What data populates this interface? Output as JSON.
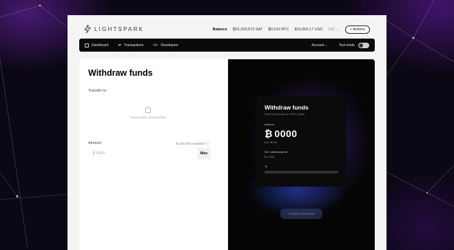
{
  "app": {
    "logo_text": "LIGHTSPARK"
  },
  "header": {
    "balance_label": "Balance",
    "balance_sat": "₿61,925,572 SAT",
    "balance_btc": "₿0.619 BTC",
    "balance_usd": "$10,666.17 USD",
    "unit_selector": "SAT",
    "actions_label": "+ Actions"
  },
  "nav": {
    "items": [
      {
        "label": "Dashboard",
        "icon": "dashboard-icon"
      },
      {
        "label": "Transactions",
        "icon": "transactions-icon"
      },
      {
        "label": "Developers",
        "icon": "code-icon"
      }
    ],
    "account_label": "Account",
    "test_mode_label": "Test mode"
  },
  "form": {
    "title": "Withdraw funds",
    "transfer_to_label": "Transfer to",
    "paste_hint": "Paste wallet and withdraw",
    "amount_label": "Amount",
    "available": "₿ 200,000 available",
    "amount_placeholder": "₿ 0000",
    "max_label": "Max"
  },
  "preview": {
    "title": "Withdraw funds",
    "subtitle": "Send funds back to a BTC wallet",
    "amount_label": "Amount",
    "amount_symbol": "₿",
    "amount_value": "0000",
    "est_label": "Est. $0.00",
    "fee_label": "Est. withdrawal fee",
    "fee_value": "₿ 1,500",
    "to_label": "To"
  },
  "confirm_label": "Confirm withdrawal",
  "colors": {
    "panel_dark": "#050505",
    "accent_purple": "#9a3cc0",
    "accent_blue": "#2850dc"
  }
}
